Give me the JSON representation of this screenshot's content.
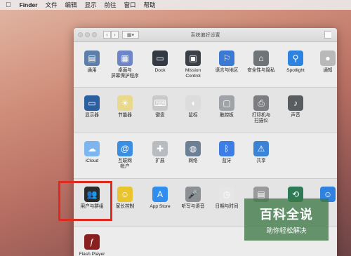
{
  "menubar": {
    "items": [
      "Finder",
      "文件",
      "编辑",
      "显示",
      "前往",
      "窗口",
      "帮助"
    ]
  },
  "window": {
    "title": "系统偏好设置",
    "nav": [
      "‹",
      "›"
    ]
  },
  "rows": [
    {
      "items": [
        {
          "label": "通用",
          "icon": "general-icon",
          "color": "#5b7fa8"
        },
        {
          "label": "桌面与\n屏幕保护程序",
          "icon": "desktop-icon",
          "color": "#6e86c8"
        },
        {
          "label": "Dock",
          "icon": "dock-icon",
          "color": "#333a44"
        },
        {
          "label": "Mission\nControl",
          "icon": "mission-control-icon",
          "color": "#3b3f48"
        },
        {
          "label": "语言与地区",
          "icon": "language-icon",
          "color": "#3b7ad3"
        },
        {
          "label": "安全性与隐私",
          "icon": "security-icon",
          "color": "#6f7478"
        },
        {
          "label": "Spotlight",
          "icon": "spotlight-icon",
          "color": "#2d84e0"
        },
        {
          "label": "通知",
          "icon": "notifications-icon",
          "color": "#b9b9b9"
        }
      ]
    },
    {
      "items": [
        {
          "label": "显示器",
          "icon": "display-icon",
          "color": "#2c5fa0"
        },
        {
          "label": "节能器",
          "icon": "energy-saver-icon",
          "color": "#e9d98c"
        },
        {
          "label": "键盘",
          "icon": "keyboard-icon",
          "color": "#c9c9c9"
        },
        {
          "label": "鼠标",
          "icon": "mouse-icon",
          "color": "#dcdcdc"
        },
        {
          "label": "触控板",
          "icon": "trackpad-icon",
          "color": "#9fa2a6"
        },
        {
          "label": "打印机与\n扫描仪",
          "icon": "printer-icon",
          "color": "#7b7d80"
        },
        {
          "label": "声音",
          "icon": "sound-icon",
          "color": "#5a5d60"
        }
      ]
    },
    {
      "items": [
        {
          "label": "iCloud",
          "icon": "icloud-icon",
          "color": "#7db6ee"
        },
        {
          "label": "互联网\n帐户",
          "icon": "internet-accounts-icon",
          "color": "#3a8fe3"
        },
        {
          "label": "扩展",
          "icon": "extensions-icon",
          "color": "#b8bbbf"
        },
        {
          "label": "网络",
          "icon": "network-icon",
          "color": "#6d7f95"
        },
        {
          "label": "蓝牙",
          "icon": "bluetooth-icon",
          "color": "#3d7ee6"
        },
        {
          "label": "共享",
          "icon": "sharing-icon",
          "color": "#3b83d6"
        }
      ]
    },
    {
      "items": [
        {
          "label": "用户与群组",
          "icon": "users-groups-icon",
          "color": "#2b2b2b"
        },
        {
          "label": "家长控制",
          "icon": "parental-controls-icon",
          "color": "#e8c52d"
        },
        {
          "label": "App Store",
          "icon": "app-store-icon",
          "color": "#2f8ef0"
        },
        {
          "label": "听写与语音",
          "icon": "dictation-icon",
          "color": "#8c8f93"
        },
        {
          "label": "日期与时间",
          "icon": "date-time-icon",
          "color": "#e6e6e6"
        },
        {
          "label": "",
          "icon": "startup-disk-icon",
          "color": "#9a9a9a"
        },
        {
          "label": "",
          "icon": "time-machine-icon",
          "color": "#2e7a55"
        },
        {
          "label": "",
          "icon": "accessibility-icon",
          "color": "#2f82e0"
        }
      ]
    },
    {
      "items": [
        {
          "label": "Flash Player",
          "icon": "flash-player-icon",
          "color": "#8a1f1f"
        }
      ]
    }
  ],
  "watermark": {
    "big": "百科全说",
    "small": "助你轻松解决"
  }
}
